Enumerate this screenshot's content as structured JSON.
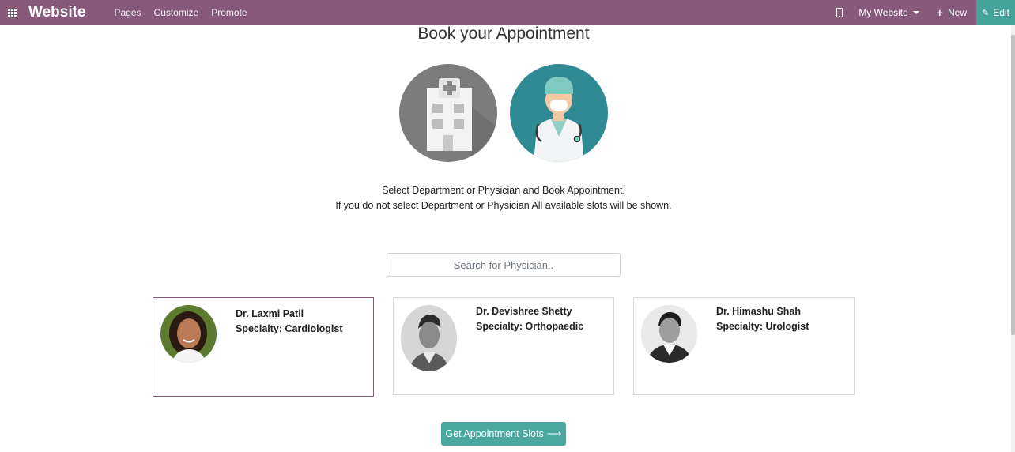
{
  "navbar": {
    "brand": "Website",
    "menu": [
      "Pages",
      "Customize",
      "Promote"
    ],
    "website_selector": "My Website",
    "new_label": "New",
    "edit_label": "Edit",
    "color": "#875a7b",
    "edit_color": "#44a39a"
  },
  "main": {
    "title": "Book your Appointment",
    "instructions": [
      "Select Department or Physician and Book Appointment.",
      "If you do not select Department or Physician All available slots will be shown."
    ],
    "search_placeholder": "Search for Physician..",
    "physicians": [
      {
        "name": "Dr. Laxmi Patil",
        "specialty": "Specialty: Cardiologist",
        "selected": true
      },
      {
        "name": "Dr. Devishree Shetty",
        "specialty": "Specialty: Orthopaedic",
        "selected": false
      },
      {
        "name": "Dr. Himashu Shah",
        "specialty": "Specialty: Urologist",
        "selected": false
      }
    ],
    "cta_label": "Get Appointment Slots",
    "cta_color": "#4aa8a0"
  },
  "icons": {
    "apps": "apps-grid-icon",
    "mobile": "mobile-preview-icon",
    "plus": "plus-icon",
    "edit": "pencil-icon",
    "arrow": "long-arrow-right-icon",
    "department": "hospital-building-icon",
    "physician": "doctor-icon"
  }
}
